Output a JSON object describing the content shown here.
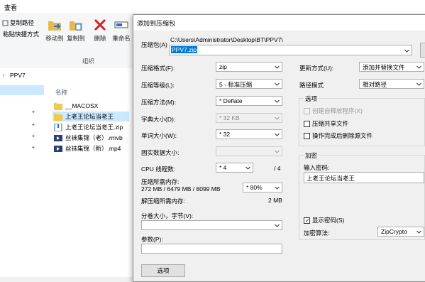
{
  "explorer": {
    "ribbon_tab": "查看",
    "ribbon": {
      "copy_path": "复制路径",
      "paste_shortcut": "粘贴快捷方式",
      "move_to": "移动到",
      "copy_to": "复制到",
      "delete": "删除",
      "rename": "重命名",
      "group_label": "组织"
    },
    "breadcrumb": "PPV7",
    "column_name": "名称",
    "files": [
      {
        "name": "__MACOSX",
        "type": "folder",
        "selected": false
      },
      {
        "name": "上老王论坛当老王",
        "type": "folder",
        "selected": true
      },
      {
        "name": "上老王论坛当老王.zip",
        "type": "zip",
        "selected": false
      },
      {
        "name": "丝袜集锦（老）.rmvb",
        "type": "video",
        "selected": false
      },
      {
        "name": "丝袜集锦（新）.mp4",
        "type": "video",
        "selected": false
      }
    ]
  },
  "dialog": {
    "title": "添加到压缩包",
    "archive_label": "压缩包(A)",
    "archive_path": "C:\\Users\\Administrator\\Desktop\\BT\\PPV7\\",
    "archive_name": "PPV7.zip",
    "format_label": "压缩格式(F):",
    "format_value": "zip",
    "level_label": "压缩等级(L):",
    "level_value": "5 - 标准压缩",
    "method_label": "压缩方法(M):",
    "method_value": "* Deflate",
    "dict_label": "字典大小(D):",
    "dict_value": "* 32 KB",
    "word_label": "单词大小(W):",
    "word_value": "* 32",
    "solid_label": "固实数据大小:",
    "solid_value": "",
    "cpu_label": "CPU 线程数:",
    "cpu_value": "* 4",
    "cpu_total": "/ 4",
    "mem_label": "压缩所需内存:",
    "mem_value": "272 MB / 6479 MB / 8099 MB",
    "mem_percent": "* 80%",
    "decomp_label": "解压缩所需内存:",
    "decomp_value": "2 MB",
    "split_label": "分卷大小，字节(V):",
    "split_value": "",
    "params_label": "参数(P):",
    "params_value": "",
    "options_button": "选项",
    "update_label": "更新方式(U):",
    "update_value": "添加并替换文件",
    "pathmode_label": "路径模式",
    "pathmode_value": "相对路径",
    "options_group": "选项",
    "opt_sfx": "创建自释放程序(X)",
    "opt_shared": "压缩共享文件",
    "opt_delete": "操作完成后删除源文件",
    "encrypt_group": "加密",
    "password_label": "输入密码:",
    "password_value": "上老王论坛当老王",
    "show_password": "显示密码(S)",
    "encrypt_method_label": "加密算法:",
    "encrypt_method_value": "ZipCrypto"
  }
}
